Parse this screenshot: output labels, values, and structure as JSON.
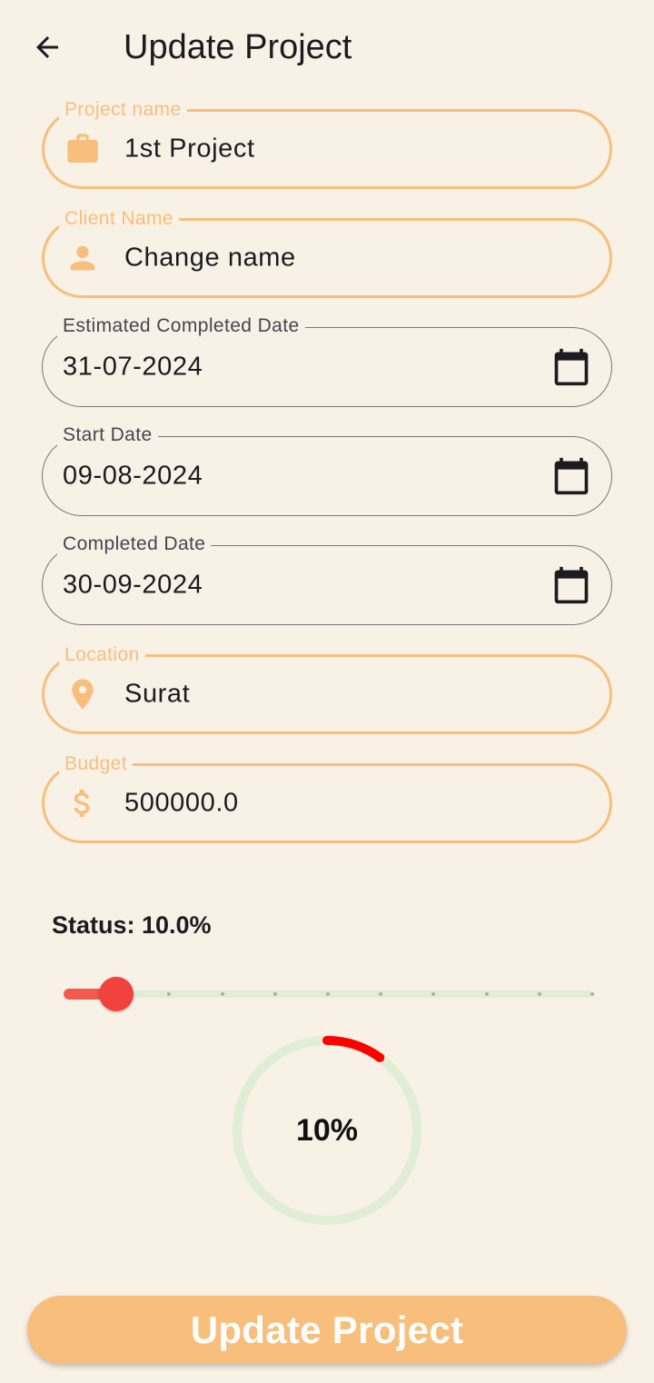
{
  "app_bar": {
    "title": "Update Project",
    "back_icon": "arrow-back-icon"
  },
  "form": {
    "project_name": {
      "label": "Project name",
      "value": "1st Project",
      "icon": "briefcase-icon"
    },
    "client_name": {
      "label": "Client Name",
      "value": "Change name",
      "icon": "person-icon"
    },
    "estimated_completed_date": {
      "label": "Estimated Completed Date",
      "value": "31-07-2024",
      "icon": "calendar-icon"
    },
    "start_date": {
      "label": "Start Date",
      "value": "09-08-2024",
      "icon": "calendar-icon"
    },
    "completed_date": {
      "label": "Completed Date",
      "value": "30-09-2024",
      "icon": "calendar-icon"
    },
    "location": {
      "label": "Location",
      "value": "Surat",
      "icon": "location-pin-icon"
    },
    "budget": {
      "label": "Budget",
      "value": "500000.0",
      "icon": "dollar-icon"
    }
  },
  "status": {
    "label": "Status: 10.0%",
    "value_percent": 10,
    "slider_divisions": 10
  },
  "progress": {
    "text": "10%",
    "fraction": 0.1
  },
  "submit": {
    "label": "Update Project"
  },
  "colors": {
    "background": "#f8f1e6",
    "accent": "#f7be7c",
    "slider_active": "#f25a4e",
    "slider_thumb": "#f2423d",
    "progress_track": "#e0eed5",
    "progress_arc": "#ff0000",
    "outline": "#79747e"
  }
}
